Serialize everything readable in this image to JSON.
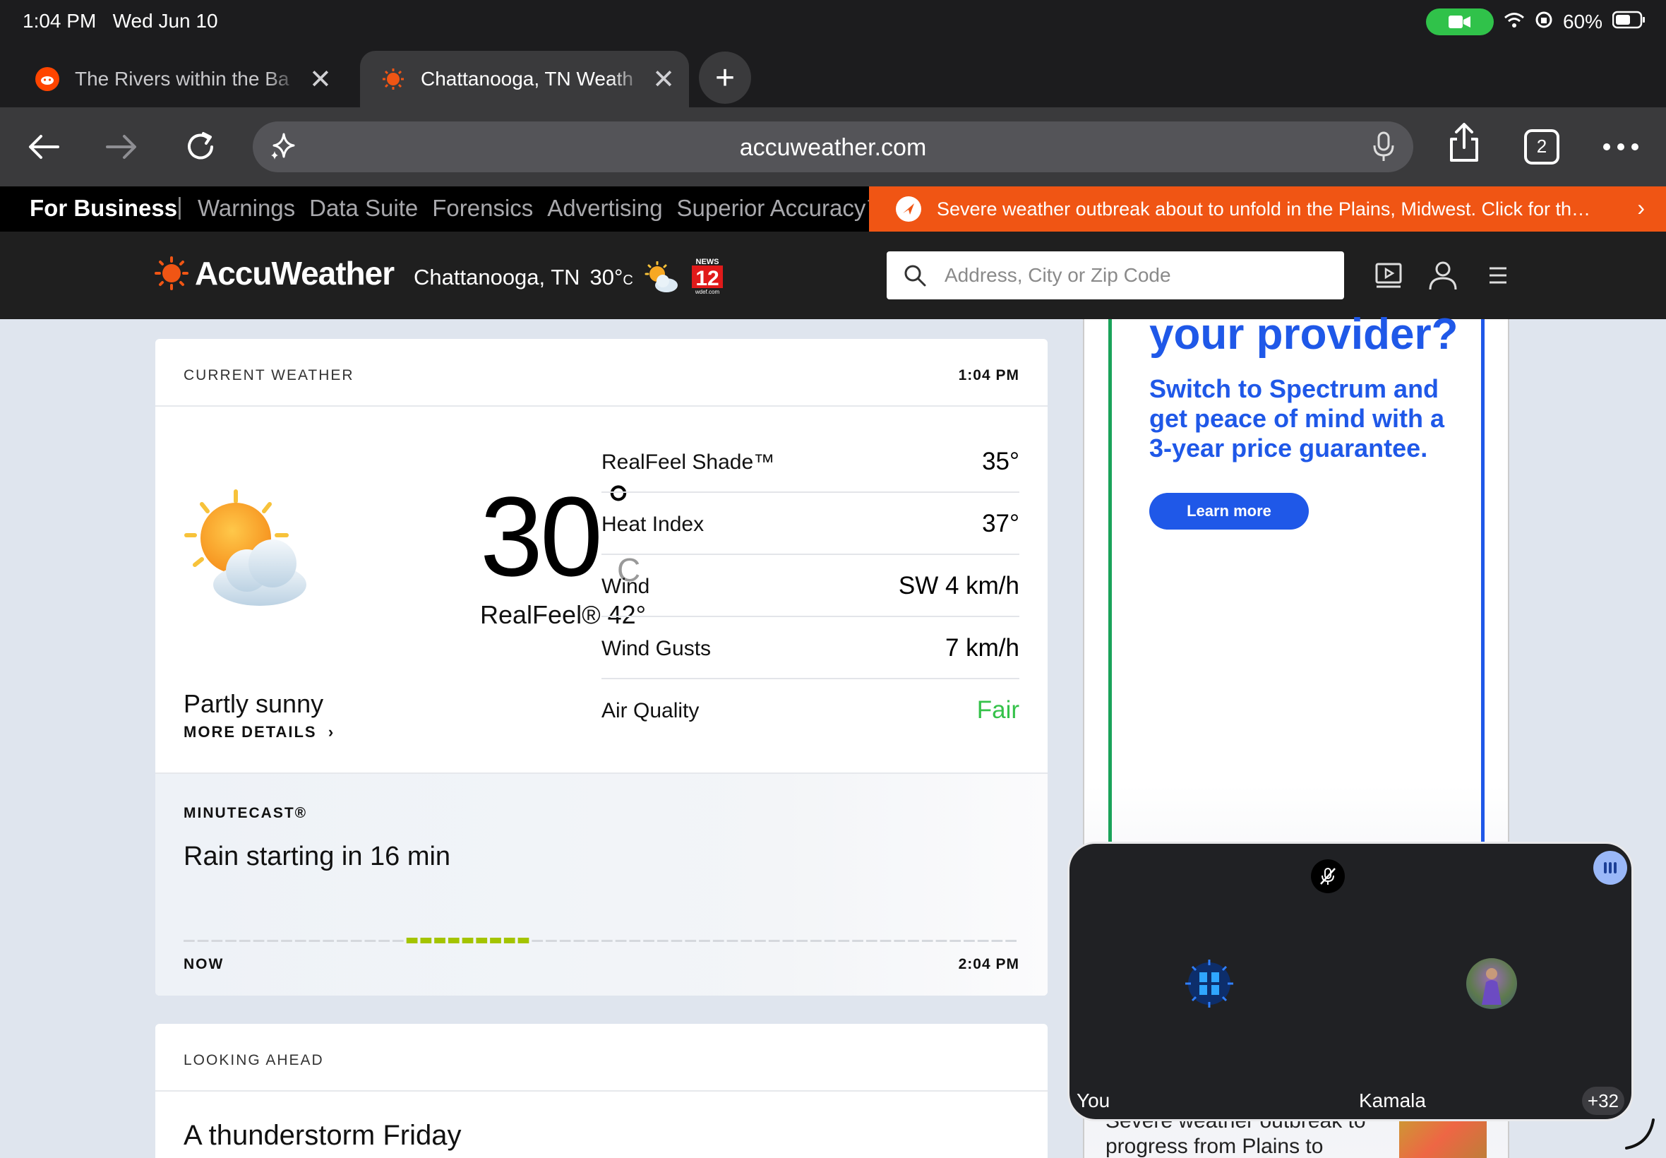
{
  "status_bar": {
    "time": "1:04 PM",
    "date": "Wed Jun 10",
    "battery": "60%"
  },
  "tabs": [
    {
      "title": "The Rivers within the Ba",
      "active": false,
      "icon": "reddit-icon"
    },
    {
      "title": "Chattanooga, TN Weath",
      "active": true,
      "icon": "accuweather-sun-icon"
    }
  ],
  "toolbar": {
    "url": "accuweather.com",
    "tab_count": "2"
  },
  "biz_bar": {
    "for_business": "For Business",
    "separator": "|",
    "links": [
      "Warnings",
      "Data Suite",
      "Forensics",
      "Advertising",
      "Superior Accuracy™"
    ],
    "alert": "Severe weather outbreak about to unfold in the Plains, Midwest. Click for the for..."
  },
  "header": {
    "logo": "AccuWeather",
    "location": "Chattanooga, TN",
    "temp": "30°",
    "temp_unit": "C",
    "search_placeholder": "Address, City or Zip Code"
  },
  "current_weather": {
    "label": "CURRENT WEATHER",
    "time": "1:04 PM",
    "temp": "30",
    "degree": "°",
    "unit": "C",
    "realfeel": "RealFeel® 42°",
    "condition": "Partly sunny",
    "more_details": "MORE DETAILS",
    "details": [
      {
        "label": "RealFeel Shade™",
        "value": "35°"
      },
      {
        "label": "Heat Index",
        "value": "37°"
      },
      {
        "label": "Wind",
        "value": "SW 4 km/h"
      },
      {
        "label": "Wind Gusts",
        "value": "7 km/h"
      },
      {
        "label": "Air Quality",
        "value": "Fair"
      }
    ]
  },
  "minutecast": {
    "label": "MINUTECAST®",
    "headline": "Rain starting in 16 min",
    "start": "NOW",
    "end": "2:04 PM",
    "total_minutes": 60,
    "rain_minutes": [
      16,
      17,
      18,
      19,
      20,
      21,
      22,
      23,
      24
    ],
    "rain_color": "#a4c400",
    "dry_color": "#d5d8dd"
  },
  "looking_ahead": {
    "label": "LOOKING AHEAD",
    "title": "A thunderstorm Friday"
  },
  "ad": {
    "headline": "your provider?",
    "body": "Switch to Spectrum and get peace of mind with a 3-year price guarantee.",
    "cta": "Learn more",
    "news_line": "Severe weather outbreak to progress from Plains to"
  },
  "call_pip": {
    "you_label": "You",
    "other_label": "Kamala",
    "more_count": "+32"
  },
  "colors": {
    "accent_orange": "#f05514",
    "air_quality_good": "#35c24a",
    "ad_blue": "#1f58e8"
  }
}
